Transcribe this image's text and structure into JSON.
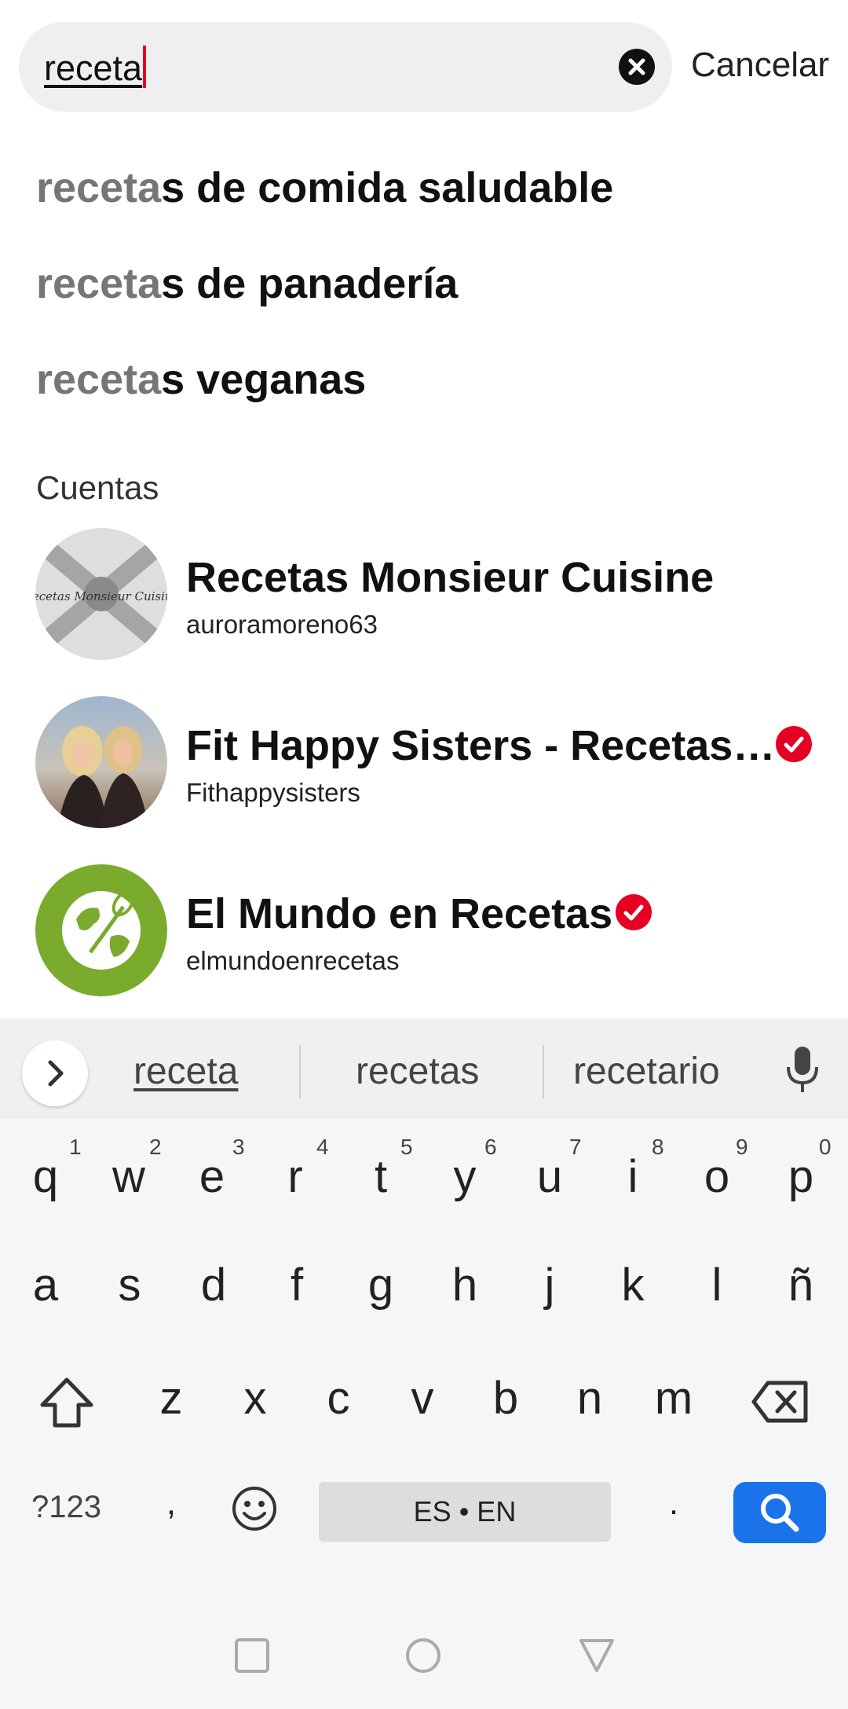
{
  "search": {
    "query": "receta",
    "cancel_label": "Cancelar"
  },
  "suggestions": [
    {
      "typed": "receta",
      "rest": "s de comida saludable"
    },
    {
      "typed": "receta",
      "rest": "s de panadería"
    },
    {
      "typed": "receta",
      "rest": "s veganas"
    }
  ],
  "accounts_section": {
    "title": "Cuentas",
    "items": [
      {
        "name": "Recetas Monsieur Cuisine",
        "username": "auroramoreno63",
        "verified": false,
        "avatar_text": "Recetas Monsieur Cuisine"
      },
      {
        "name": "Fit Happy Sisters - Recetas…",
        "username": "Fithappysisters",
        "verified": true
      },
      {
        "name": "El Mundo en Recetas",
        "username": "elmundoenrecetas",
        "verified": true
      }
    ]
  },
  "keyboard": {
    "suggestions": [
      "receta",
      "recetas",
      "recetario"
    ],
    "row1": [
      "q",
      "w",
      "e",
      "r",
      "t",
      "y",
      "u",
      "i",
      "o",
      "p"
    ],
    "row1_hints": [
      "1",
      "2",
      "3",
      "4",
      "5",
      "6",
      "7",
      "8",
      "9",
      "0"
    ],
    "row2": [
      "a",
      "s",
      "d",
      "f",
      "g",
      "h",
      "j",
      "k",
      "l",
      "ñ"
    ],
    "row3": [
      "z",
      "x",
      "c",
      "v",
      "b",
      "n",
      "m"
    ],
    "symbols_label": "?123",
    "comma": ",",
    "period": ".",
    "space_label": "ES • EN"
  },
  "colors": {
    "accent": "#e60023",
    "search_key": "#1a73e8",
    "search_bg": "#efefef"
  },
  "icons": [
    "clear-icon",
    "verified-icon",
    "chevron-right-icon",
    "microphone-icon",
    "shift-icon",
    "backspace-icon",
    "emoji-icon",
    "search-icon",
    "nav-recents-icon",
    "nav-home-icon",
    "nav-back-icon"
  ]
}
